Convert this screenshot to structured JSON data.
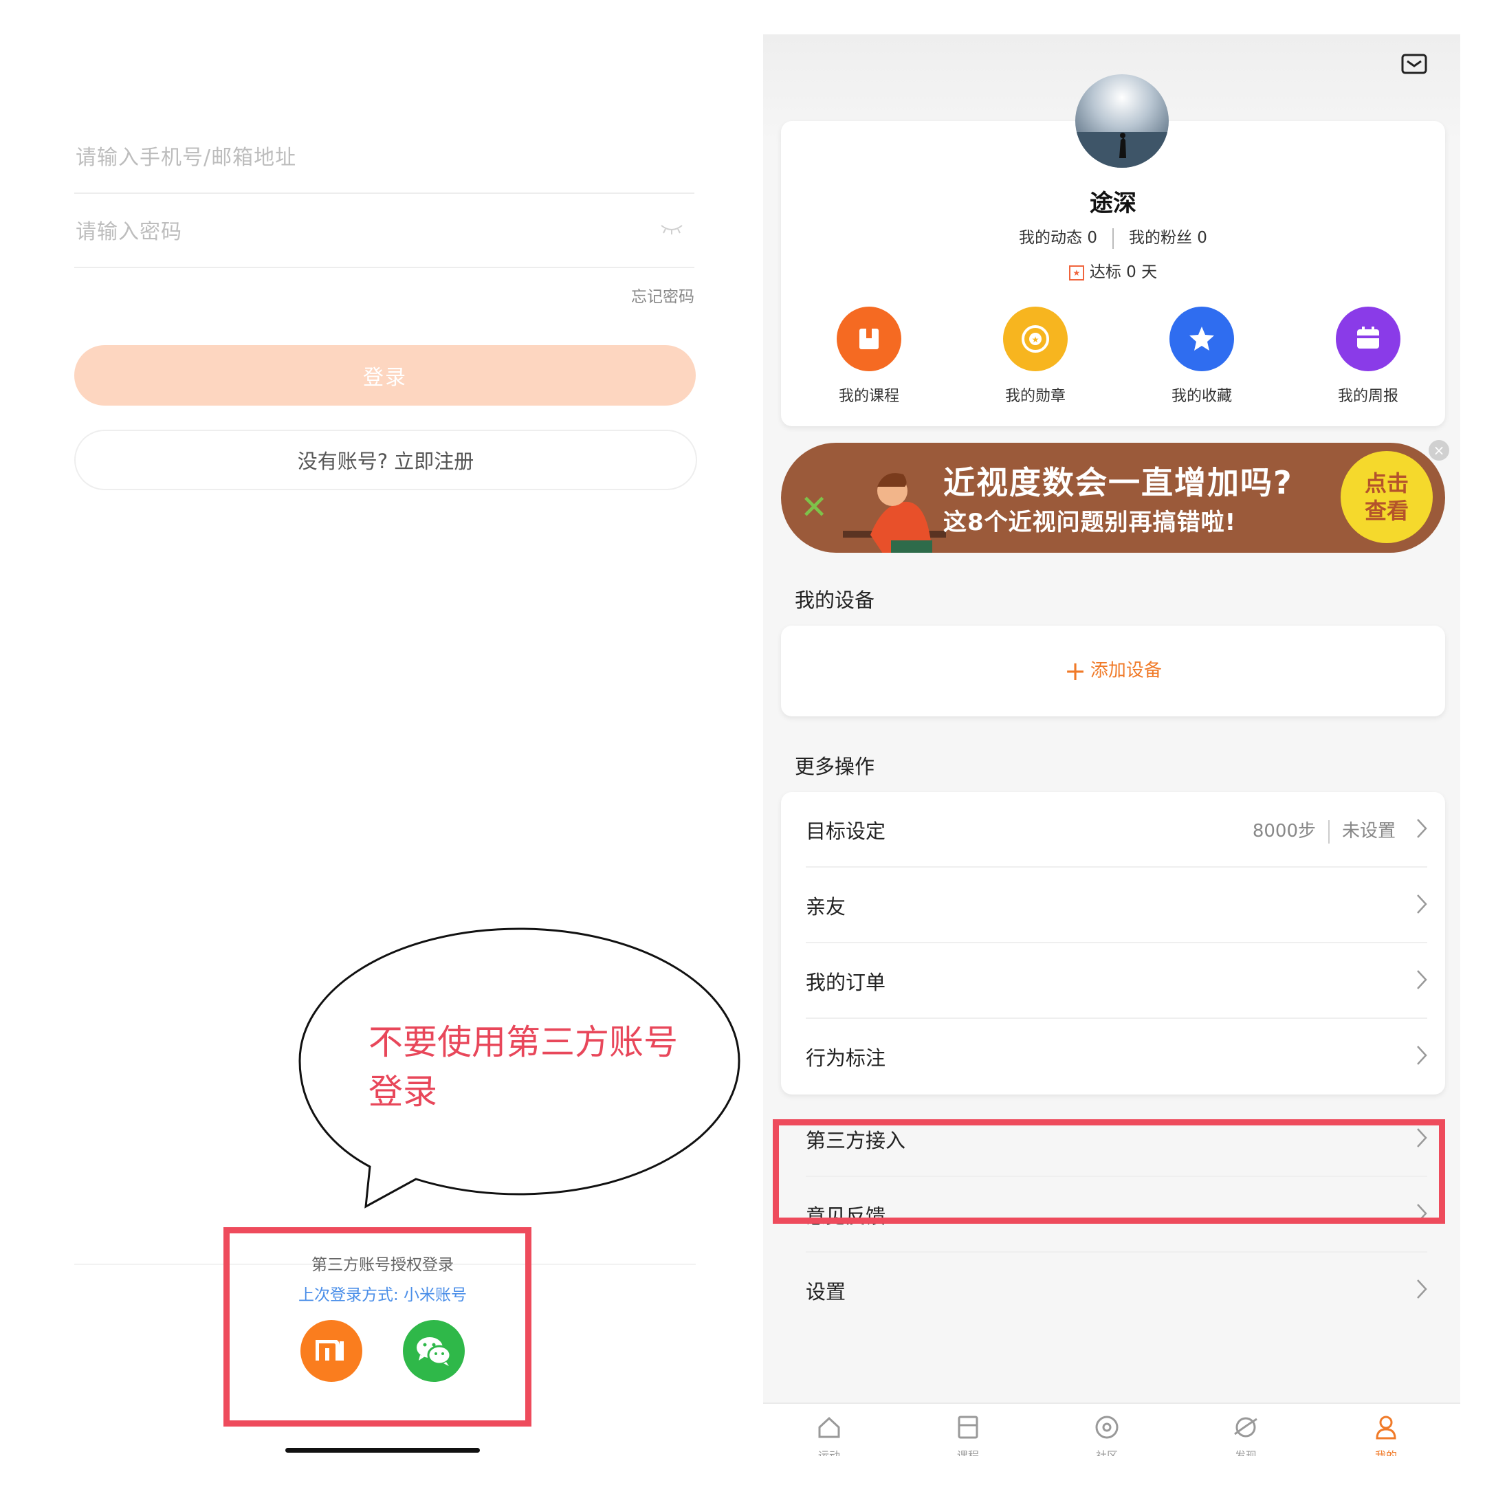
{
  "login": {
    "phone_placeholder": "请输入手机号/邮箱地址",
    "password_placeholder": "请输入密码",
    "forgot_password": "忘记密码",
    "login_button": "登录",
    "register_button": "没有账号? 立即注册",
    "third_party_title": "第三方账号授权登录",
    "last_login": "上次登录方式: 小米账号",
    "mi_icon": "mi-logo-icon",
    "wechat_icon": "wechat-icon"
  },
  "annotation": {
    "bubble_text": "不要使用第三方账号登录",
    "highlight_color": "#ee4b5c"
  },
  "profile": {
    "username": "途深",
    "posts_label": "我的动态 0",
    "fans_label": "我的粉丝 0",
    "goal_days": "达标 0 天",
    "quick_actions": [
      {
        "label": "我的课程",
        "icon": "book-icon",
        "color": "#f56a22"
      },
      {
        "label": "我的勋章",
        "icon": "medal-icon",
        "color": "#f7b51f"
      },
      {
        "label": "我的收藏",
        "icon": "star-icon",
        "color": "#2f6df0"
      },
      {
        "label": "我的周报",
        "icon": "calendar-icon",
        "color": "#8a3be8"
      }
    ]
  },
  "banner": {
    "line1": "近视度数会一直增加吗?",
    "line2": "这8个近视问题别再搞错啦!",
    "cta": "点击查看"
  },
  "devices": {
    "section_title": "我的设备",
    "add_label": "添加设备"
  },
  "more": {
    "section_title": "更多操作",
    "items": [
      {
        "label": "目标设定",
        "meta1": "8000步",
        "meta2": "未设置"
      },
      {
        "label": "亲友"
      },
      {
        "label": "我的订单"
      },
      {
        "label": "行为标注"
      },
      {
        "label": "第三方接入"
      },
      {
        "label": "意见反馈"
      },
      {
        "label": "设置"
      }
    ]
  },
  "tabs": [
    {
      "icon": "home-icon",
      "label": "运动"
    },
    {
      "icon": "course-icon",
      "label": "课程"
    },
    {
      "icon": "community-icon",
      "label": "社区"
    },
    {
      "icon": "discover-icon",
      "label": "发现"
    },
    {
      "icon": "profile-icon",
      "label": "我的",
      "active": true
    }
  ],
  "colors": {
    "accent": "#f07a28",
    "login_disabled": "#fdd6c0"
  }
}
